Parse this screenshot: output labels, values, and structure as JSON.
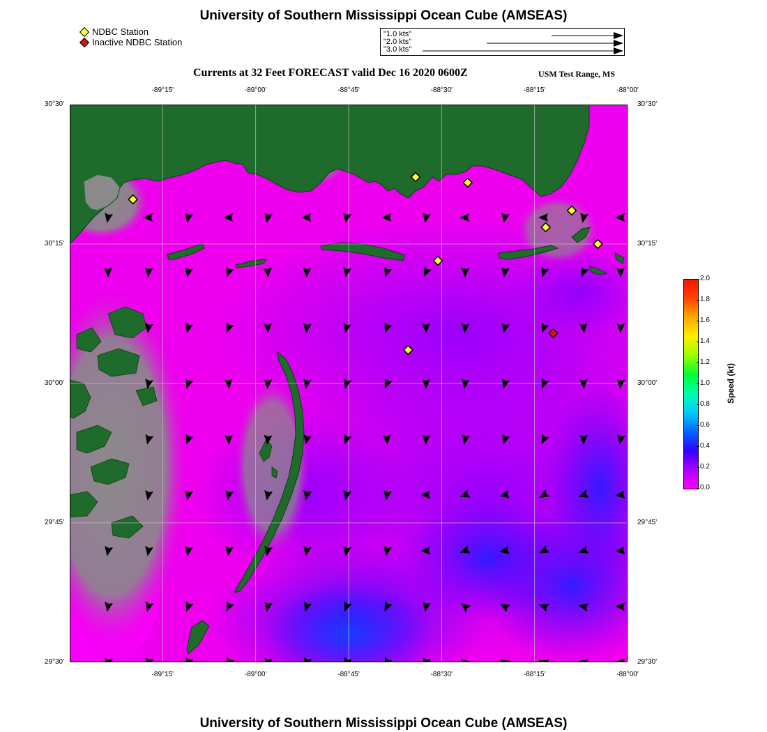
{
  "header": {
    "title": "University of Southern Mississippi Ocean Cube (AMSEAS)",
    "subtitle": "Currents at 32 Feet FORECAST valid Dec 16 2020 0600Z",
    "range_label": "USM Test Range, MS"
  },
  "footer": {
    "title": "University of Southern Mississippi Ocean Cube (AMSEAS)"
  },
  "legend": {
    "active_label": "NDBC Station",
    "inactive_label": "Inactive NDBC Station",
    "active_color": "#ffff33",
    "inactive_color": "#dd1111"
  },
  "vector_scale": {
    "items": [
      {
        "label": "1.0 kts",
        "speed": 1.0
      },
      {
        "label": "2.0 kts",
        "speed": 2.0
      },
      {
        "label": "3.0 kts",
        "speed": 3.0
      }
    ]
  },
  "map": {
    "x_ticks": [
      "-89°15'",
      "-89°00'",
      "-88°45'",
      "-88°30'",
      "-88°15'",
      "-88°00'"
    ],
    "y_ticks": [
      "30°30'",
      "30°15'",
      "30°00'",
      "29°45'",
      "29°30'"
    ],
    "land_color": "#1f6b2b",
    "marsh_color": "#8a8a8a",
    "water_color": "#ee00ee",
    "stations_active": [
      {
        "lon": -89.33,
        "lat": 30.33
      },
      {
        "lon": -88.57,
        "lat": 30.37
      },
      {
        "lon": -88.43,
        "lat": 30.36
      },
      {
        "lon": -88.22,
        "lat": 30.28
      },
      {
        "lon": -88.15,
        "lat": 30.31
      },
      {
        "lon": -88.08,
        "lat": 30.25
      },
      {
        "lon": -88.51,
        "lat": 30.22
      },
      {
        "lon": -88.59,
        "lat": 30.06
      }
    ],
    "stations_inactive": [
      {
        "lon": -88.2,
        "lat": 30.09
      }
    ]
  },
  "colorbar": {
    "label": "Speed (kt)",
    "ticks": [
      "0.0",
      "0.2",
      "0.4",
      "0.6",
      "0.8",
      "1.0",
      "1.2",
      "1.4",
      "1.6",
      "1.8",
      "2.0"
    ],
    "colors": [
      "#ff00ff",
      "#aa00ff",
      "#3300ff",
      "#0066ff",
      "#00ccff",
      "#00ffaa",
      "#00ff33",
      "#99ff00",
      "#ffee00",
      "#ffaa00",
      "#ff4400",
      "#ff1100"
    ]
  }
}
